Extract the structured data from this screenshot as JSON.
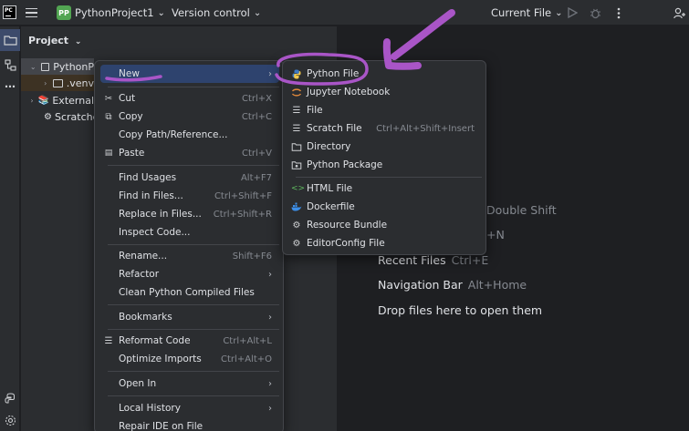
{
  "titlebar": {
    "app_logo": "PC",
    "project_badge": "PP",
    "project_name": "PythonProject1",
    "version_control": "Version control",
    "run_config": "Current File",
    "chevron": "⌄"
  },
  "icons": {
    "hamburger": "menu-icon",
    "run": "play-icon",
    "debug": "bug-icon",
    "more": "more-vertical-icon",
    "add_user": "add-user-icon"
  },
  "project_panel": {
    "header": "Project",
    "tree": [
      {
        "label": "PythonP",
        "expanded": true
      },
      {
        "label": ".venv"
      },
      {
        "label": "External"
      },
      {
        "label": "Scratche"
      }
    ]
  },
  "context_menu": {
    "items": [
      {
        "label": "New",
        "submenu": true,
        "active": true
      },
      {
        "label": "Cut",
        "shortcut": "Ctrl+X",
        "icon": "✂"
      },
      {
        "label": "Copy",
        "shortcut": "Ctrl+C",
        "icon": "⧉"
      },
      {
        "label": "Copy Path/Reference..."
      },
      {
        "label": "Paste",
        "shortcut": "Ctrl+V",
        "icon": "📋"
      },
      {
        "label": "Find Usages",
        "shortcut": "Alt+F7"
      },
      {
        "label": "Find in Files...",
        "shortcut": "Ctrl+Shift+F"
      },
      {
        "label": "Replace in Files...",
        "shortcut": "Ctrl+Shift+R"
      },
      {
        "label": "Inspect Code..."
      },
      {
        "label": "Rename...",
        "shortcut": "Shift+F6"
      },
      {
        "label": "Refactor",
        "submenu": true
      },
      {
        "label": "Clean Python Compiled Files"
      },
      {
        "label": "Bookmarks",
        "submenu": true
      },
      {
        "label": "Reformat Code",
        "shortcut": "Ctrl+Alt+L",
        "icon": "☰"
      },
      {
        "label": "Optimize Imports",
        "shortcut": "Ctrl+Alt+O"
      },
      {
        "label": "Open In",
        "submenu": true
      },
      {
        "label": "Local History",
        "submenu": true
      },
      {
        "label": "Repair IDE on File"
      }
    ],
    "arrow": "›"
  },
  "new_submenu": {
    "items": [
      {
        "label": "Python File",
        "icon": "python-icon",
        "color": "#f2c94c"
      },
      {
        "label": "Jupyter Notebook",
        "icon": "jupyter-icon",
        "color": "#e38a3b"
      },
      {
        "label": "File",
        "icon": "file-icon"
      },
      {
        "label": "Scratch File",
        "shortcut": "Ctrl+Alt+Shift+Insert",
        "icon": "scratch-file-icon"
      },
      {
        "label": "Directory",
        "icon": "folder-icon"
      },
      {
        "label": "Python Package",
        "icon": "package-icon"
      },
      {
        "label": "HTML File",
        "icon": "html-icon",
        "color": "#5fb85f"
      },
      {
        "label": "Dockerfile",
        "icon": "docker-icon",
        "color": "#3c8ee8"
      },
      {
        "label": "Resource Bundle",
        "icon": "gear-icon"
      },
      {
        "label": "EditorConfig File",
        "icon": "gear-icon"
      }
    ]
  },
  "editor_hints": [
    {
      "label": "",
      "shortcut": "Double Shift"
    },
    {
      "label": "",
      "shortcut": "+N"
    },
    {
      "label": "Recent Files",
      "shortcut": "Ctrl+E"
    },
    {
      "label": "Navigation Bar",
      "shortcut": "Alt+Home"
    },
    {
      "label": "Drop files here to open them",
      "shortcut": ""
    }
  ],
  "annotation_color": "#a955c7"
}
